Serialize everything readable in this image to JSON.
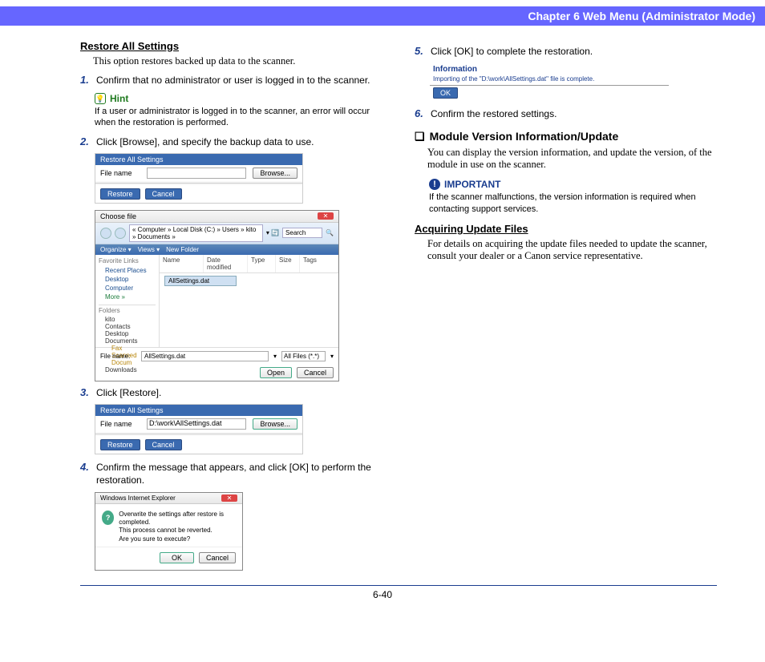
{
  "header": {
    "chapter": "Chapter 6   Web Menu (Administrator Mode)"
  },
  "left": {
    "restore_title": "Restore All Settings",
    "restore_desc": "This option restores backed up data to the scanner.",
    "step1": "Confirm that no administrator or user is logged in to the scanner.",
    "hint_label": "Hint",
    "hint_body": "If a user or administrator is logged in to the scanner, an error will occur when the restoration is performed.",
    "step2": "Click [Browse], and specify the backup data to use.",
    "step3": "Click [Restore].",
    "step4": "Confirm the message that appears, and click [OK] to perform the restoration.",
    "shot1": {
      "title": "Restore All Settings",
      "file_label": "File name",
      "browse": "Browse...",
      "restore": "Restore",
      "cancel": "Cancel"
    },
    "choose": {
      "title": "Choose file",
      "addr": "« Computer » Local Disk (C:) » Users » kito » Documents »",
      "search": "Search",
      "org": "Organize ▾",
      "views": "Views ▾",
      "newf": "New Folder",
      "fav": "Favorite Links",
      "recent": "Recent Places",
      "desktop": "Desktop",
      "computer": "Computer",
      "more": "More »",
      "folders": "Folders",
      "h_name": "Name",
      "h_dm": "Date modified",
      "h_type": "Type",
      "h_size": "Size",
      "h_tags": "Tags",
      "sel": "AllSettings.dat",
      "f_kito": "kito",
      "f_contacts": "Contacts",
      "f_desktop": "Desktop",
      "f_docs": "Documents",
      "f_fax": "Fax",
      "f_scan": "Scanned Docum",
      "f_dl": "Downloads",
      "fn_label": "File name:",
      "fn_value": "AllSettings.dat",
      "filter": "All Files (*.*)",
      "open": "Open",
      "cancel": "Cancel"
    },
    "shot3": {
      "title": "Restore All Settings",
      "file_label": "File name",
      "file_value": "D:\\work\\AllSettings.dat",
      "browse": "Browse...",
      "restore": "Restore",
      "cancel": "Cancel"
    },
    "ie": {
      "title": "Windows Internet Explorer",
      "msg": "Overwrite the settings after restore is completed.\nThis process cannot be reverted.\nAre you sure to execute?",
      "ok": "OK",
      "cancel": "Cancel"
    }
  },
  "right": {
    "step5": "Click [OK] to complete the restoration.",
    "info": {
      "title": "Information",
      "msg": "Importing of the \"D:\\work\\AllSettings.dat\" file is complete.",
      "ok": "OK"
    },
    "step6": "Confirm the restored settings.",
    "mod_marker": "❏",
    "mod_title": "Module Version Information/Update",
    "mod_desc": "You can display the version information, and update the version, of the module in use on the scanner.",
    "imp_label": "IMPORTANT",
    "imp_body": "If the scanner malfunctions, the version information is required when contacting support services.",
    "acq_title": "Acquiring Update Files",
    "acq_desc": "For details on acquiring the update files needed to update the scanner, consult your dealer or a Canon service representative."
  },
  "footer": {
    "page": "6-40"
  }
}
